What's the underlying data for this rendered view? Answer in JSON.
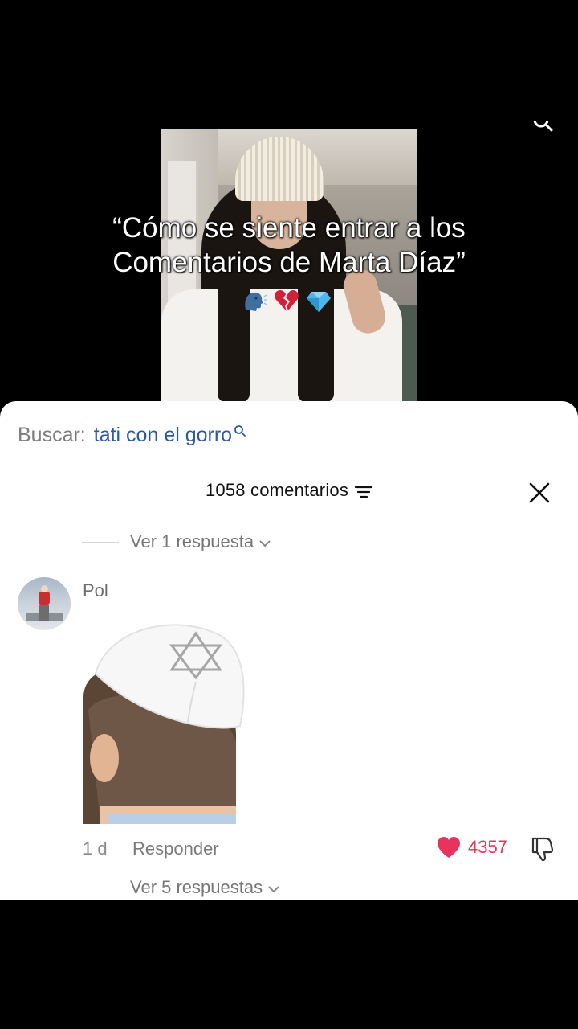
{
  "video": {
    "caption_line1": "“Cómo se siente entrar a los",
    "caption_line2": "Comentarios de Marta Díaz”",
    "emojis": [
      "speaking-head",
      "broken-heart",
      "gem"
    ]
  },
  "search": {
    "prefix": "Buscar:",
    "query": "tati con el gorro"
  },
  "comments": {
    "count_label": "1058 comentarios",
    "previous_replies": "Ver 1 respuesta",
    "items": [
      {
        "username": "Pol",
        "time": "1 d",
        "reply_label": "Responder",
        "likes": "4357",
        "replies_label": "Ver 5 respuestas"
      }
    ]
  },
  "colors": {
    "like": "#e8345d",
    "search_query": "#2b5aa5",
    "sheet_bg": "#ffffff"
  }
}
